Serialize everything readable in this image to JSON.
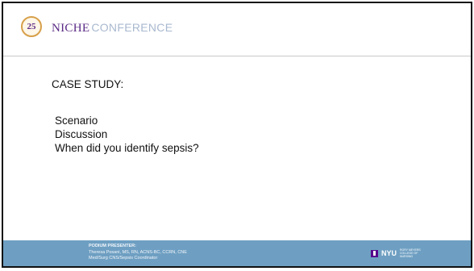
{
  "header": {
    "badge_number": "25",
    "brand_primary": "NICHE",
    "brand_secondary": "CONFERENCE"
  },
  "slide": {
    "title": "CASE STUDY:",
    "items": [
      "Scenario",
      "Discussion",
      "When did you identify sepsis?"
    ]
  },
  "footer": {
    "presenter_label": "PODIUM PRESENTER:",
    "presenter_name": "Theresa Posani, MS, RN, ACNS-BC, CCRN, CNE",
    "presenter_role": "Med/Surg CNS/Sepsis Coordinator",
    "nyu_text": "NYU",
    "school_text": "RORY MEYERS COLLEGE OF NURSING"
  },
  "colors": {
    "footer_bg": "#6e9fc2",
    "brand_purple": "#5b2a86",
    "brand_light": "#a9b9d0",
    "badge_gold": "#d7a04a"
  },
  "icons": {
    "badge": "anniversary-badge-icon",
    "nyu": "nyu-torch-icon"
  }
}
